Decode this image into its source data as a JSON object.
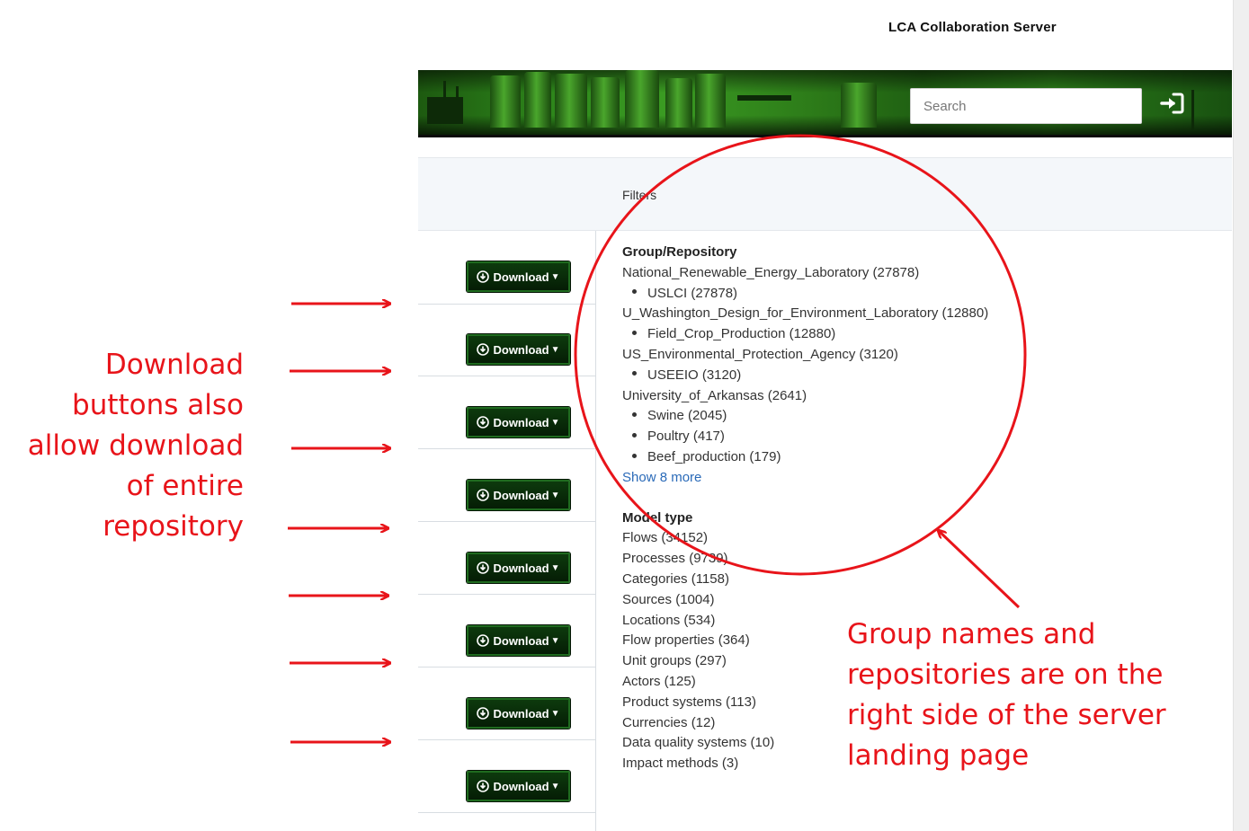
{
  "header": {
    "app_title": "LCA Collaboration Server"
  },
  "search": {
    "placeholder": "Search"
  },
  "icons": {
    "login": "sign-in-icon",
    "download": "circle-arrow-down-icon",
    "caret": "caret-down-icon"
  },
  "download_buttons": [
    {
      "label": "Download"
    },
    {
      "label": "Download"
    },
    {
      "label": "Download"
    },
    {
      "label": "Download"
    },
    {
      "label": "Download"
    },
    {
      "label": "Download"
    },
    {
      "label": "Download"
    },
    {
      "label": "Download"
    }
  ],
  "filters": {
    "title": "Filters",
    "group_repository": {
      "heading": "Group/Repository",
      "groups": [
        {
          "name": "National_Renewable_Energy_Laboratory (27878)",
          "repos": [
            "USLCI (27878)"
          ]
        },
        {
          "name": "U_Washington_Design_for_Environment_Laboratory (12880)",
          "repos": [
            "Field_Crop_Production (12880)"
          ]
        },
        {
          "name": "US_Environmental_Protection_Agency (3120)",
          "repos": [
            "USEEIO (3120)"
          ]
        },
        {
          "name": "University_of_Arkansas (2641)",
          "repos": [
            "Swine (2045)",
            "Poultry (417)",
            "Beef_production (179)"
          ]
        }
      ],
      "show_more": "Show 8 more"
    },
    "model_type": {
      "heading": "Model type",
      "items": [
        "Flows (34152)",
        "Processes (9739)",
        "Categories (1158)",
        "Sources (1004)",
        "Locations (534)",
        "Flow properties (364)",
        "Unit groups (297)",
        "Actors (125)",
        "Product systems (113)",
        "Currencies (12)",
        "Data quality systems (10)",
        "Impact methods (3)"
      ]
    }
  },
  "annotations": {
    "left_text": [
      "Download",
      "buttons also",
      "allow download",
      "of entire",
      "repository"
    ],
    "right_text": [
      "Group names and",
      "repositories are on the",
      "right side of the server",
      "landing page"
    ],
    "color": "#e8141a"
  },
  "colors": {
    "button_bg": "#0a2a0a",
    "button_border": "#1f6b1f",
    "link": "#2a6ab8",
    "banner_green": "#2f8a1c"
  }
}
